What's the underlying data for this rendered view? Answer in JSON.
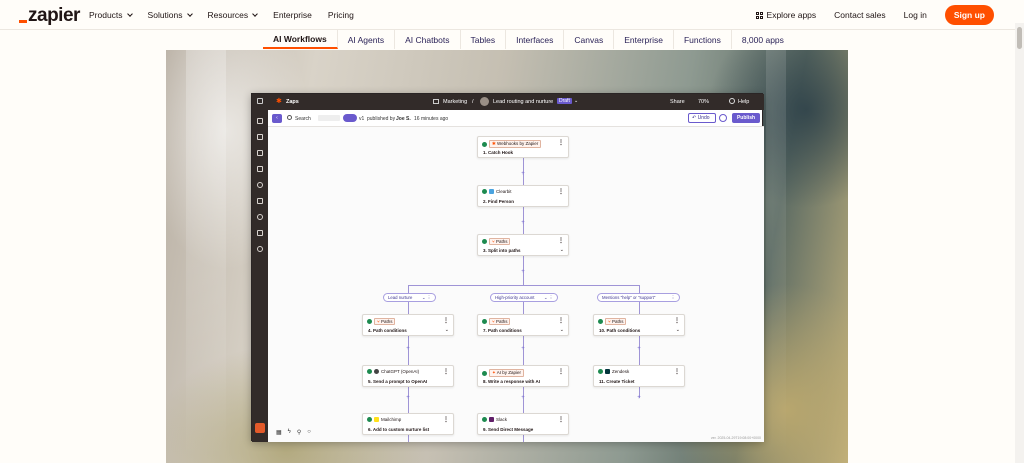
{
  "topnav": {
    "logo": "zapier",
    "items": [
      "Products",
      "Solutions",
      "Resources",
      "Enterprise",
      "Pricing"
    ],
    "explore": "Explore apps",
    "contact": "Contact sales",
    "login": "Log in",
    "signup": "Sign up"
  },
  "subnav": [
    "AI Workflows",
    "AI Agents",
    "AI Chatbots",
    "Tables",
    "Interfaces",
    "Canvas",
    "Enterprise",
    "Functions",
    "8,000 apps"
  ],
  "app": {
    "title": "Zaps",
    "breadcrumb_folder": "Marketing",
    "zap_name": "Lead routing and nurture",
    "status": "Draft",
    "share": "Share",
    "zoom": "70%",
    "help": "Help",
    "search": "Search",
    "version": "v1",
    "published": "published by",
    "author": "Joe S.",
    "time": "16 minutes ago",
    "undo": "Undo",
    "publish": "Publish",
    "footer": "ver. 2025-04-29T19:08:00+0000"
  },
  "nodes": [
    {
      "app": "Webhooks by Zapier",
      "step": "1. Catch Hook"
    },
    {
      "app": "Clearbit",
      "step": "2. Find Person"
    },
    {
      "app": "Paths",
      "step": "3. Split into paths"
    },
    {
      "app": "Paths",
      "step": "4. Path conditions"
    },
    {
      "app": "Paths",
      "step": "7. Path conditions"
    },
    {
      "app": "Paths",
      "step": "10. Path conditions"
    },
    {
      "app": "ChatGPT (OpenAI)",
      "step": "5. Send a prompt to OpenAI"
    },
    {
      "app": "AI by Zapier",
      "step": "8. Write a response with AI"
    },
    {
      "app": "Zendesk",
      "step": "11. Create Ticket"
    },
    {
      "app": "Mailchimp",
      "step": "6. Add to custom nurture list"
    },
    {
      "app": "Slack",
      "step": "9. Send Direct Message"
    }
  ],
  "branches": [
    "Lead nurture",
    "High-priority account",
    "Mentions \"help\" or \"support\""
  ],
  "colors": {
    "accent": "#ff4f00",
    "purple": "#6a5acd",
    "dark": "#322b29"
  }
}
